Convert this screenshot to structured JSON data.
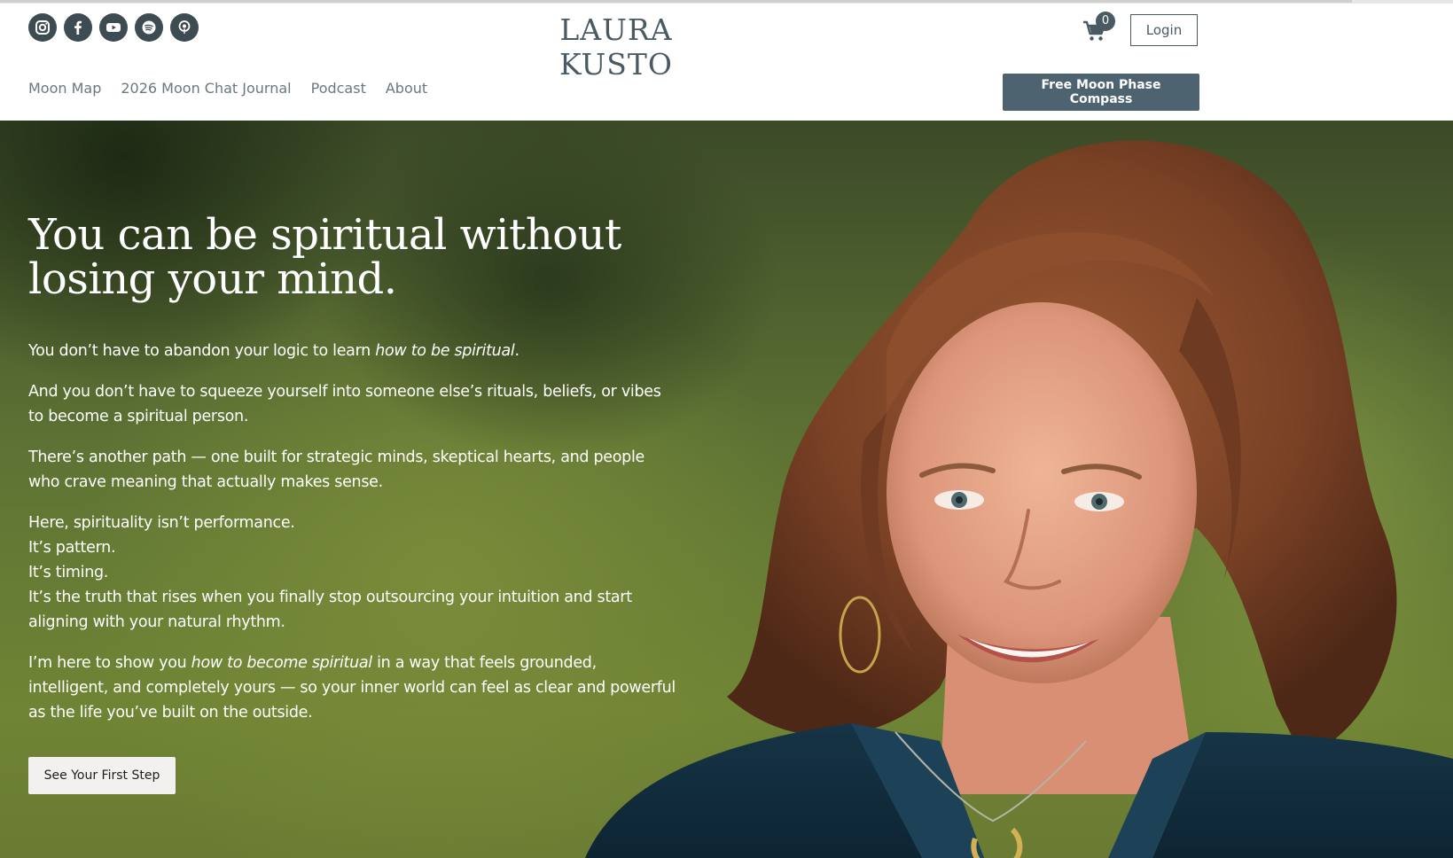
{
  "header": {
    "brand": "LAURA KUSTO",
    "socials": [
      {
        "name": "instagram-icon"
      },
      {
        "name": "facebook-icon"
      },
      {
        "name": "youtube-icon"
      },
      {
        "name": "spotify-icon"
      },
      {
        "name": "podcast-icon"
      }
    ],
    "cart_count": "0",
    "login_label": "Login",
    "nav": [
      "Moon Map",
      "2026 Moon Chat Journal",
      "Podcast",
      "About"
    ],
    "cta_label": "Free Moon Phase Compass"
  },
  "hero": {
    "headline": "You can be spiritual without losing your mind.",
    "p1_before": "You don’t have to abandon your logic to learn ",
    "p1_em": "how to be spiritual",
    "p1_after": ".",
    "p2": "And you don’t have to squeeze yourself into someone else’s rituals, beliefs, or vibes to become a spiritual person.",
    "p3": "There’s another path — one built for strategic minds, skeptical hearts, and people who crave meaning that actually makes sense.",
    "p4_lines": [
      "Here, spirituality isn’t performance.",
      "It’s pattern.",
      "It’s timing.",
      "It’s the truth that rises when you finally stop outsourcing your intuition and start aligning with your natural rhythm."
    ],
    "p5_before": "I’m here to show you ",
    "p5_em": "how to become spiritual",
    "p5_after": " in a way that feels grounded, intelligent, and completely yours — so your inner world can feel as clear and powerful as the life you’ve built on the outside.",
    "cta_label": "See Your First Step"
  },
  "colors": {
    "accent": "#4d6370",
    "brand_text": "#4a5a63",
    "hero_green": "#5e7334"
  }
}
